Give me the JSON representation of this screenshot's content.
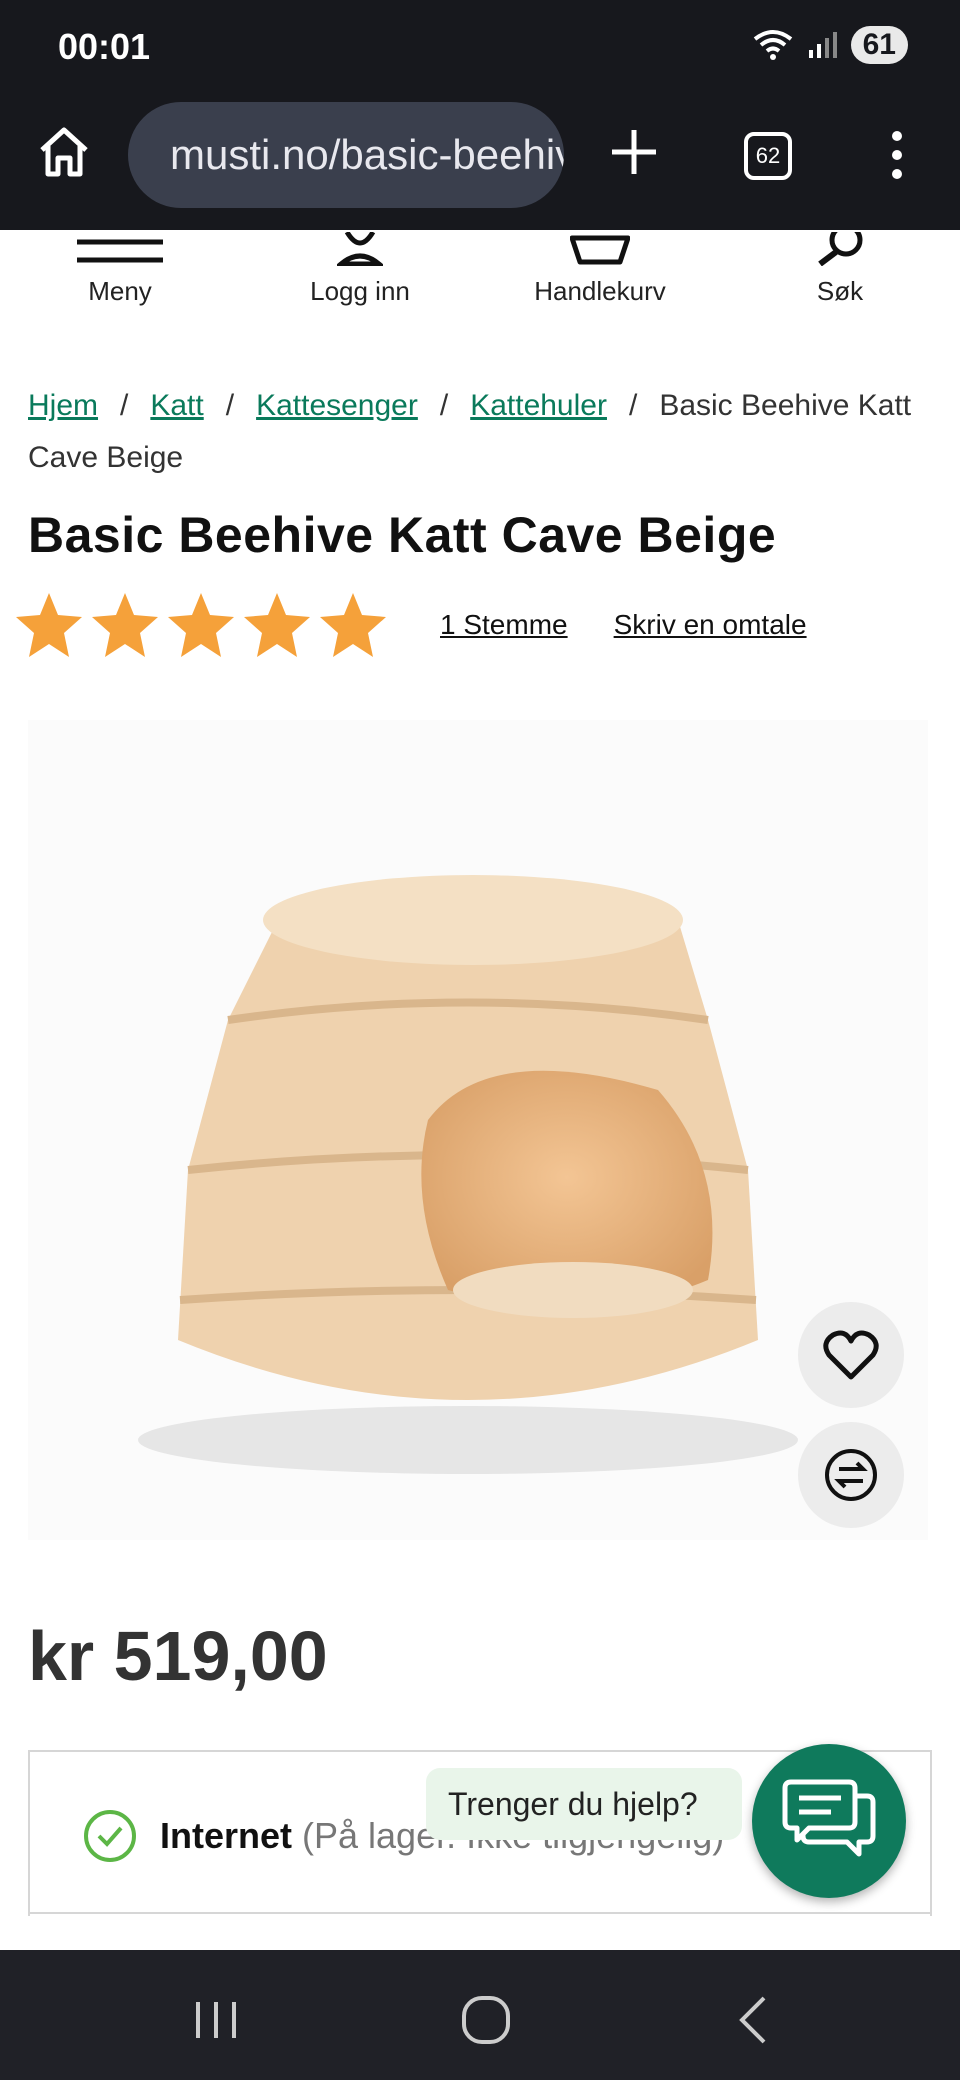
{
  "status_bar": {
    "time": "00:01",
    "battery": "61"
  },
  "browser": {
    "url": "musti.no/basic-beehive-katt-cave-beige",
    "tab_count": "62"
  },
  "site_nav": [
    {
      "label": "Meny",
      "icon": "hamburger-menu-icon"
    },
    {
      "label": "Logg inn",
      "icon": "user-icon"
    },
    {
      "label": "Handlekurv",
      "icon": "basket-icon"
    },
    {
      "label": "Søk",
      "icon": "search-icon"
    }
  ],
  "breadcrumb": {
    "links": [
      "Hjem",
      "Katt",
      "Kattesenger",
      "Kattehuler"
    ],
    "current": "Basic Beehive Katt Cave Beige",
    "separator": "/"
  },
  "product": {
    "title": "Basic Beehive Katt Cave Beige",
    "rating": 5,
    "rating_max": 5,
    "votes_label": "1 Stemme",
    "review_label": "Skriv en omtale",
    "price": "kr 519,00",
    "image_icon": "cat-cave-bed-image"
  },
  "actions": {
    "favorite_icon": "heart-icon",
    "compare_icon": "compare-arrows-icon"
  },
  "availability": {
    "label": "Internet",
    "detail": "(På lager. Ikke tilgjengelig)",
    "icon": "check-circle-icon"
  },
  "help": {
    "bubble_text": "Trenger du hjelp?",
    "icon": "chat-icon"
  },
  "colors": {
    "link_green": "#0a7a5b",
    "star_orange": "#f5a13a",
    "chat_green": "#0f7a5c",
    "chrome_bg": "#17181d"
  }
}
